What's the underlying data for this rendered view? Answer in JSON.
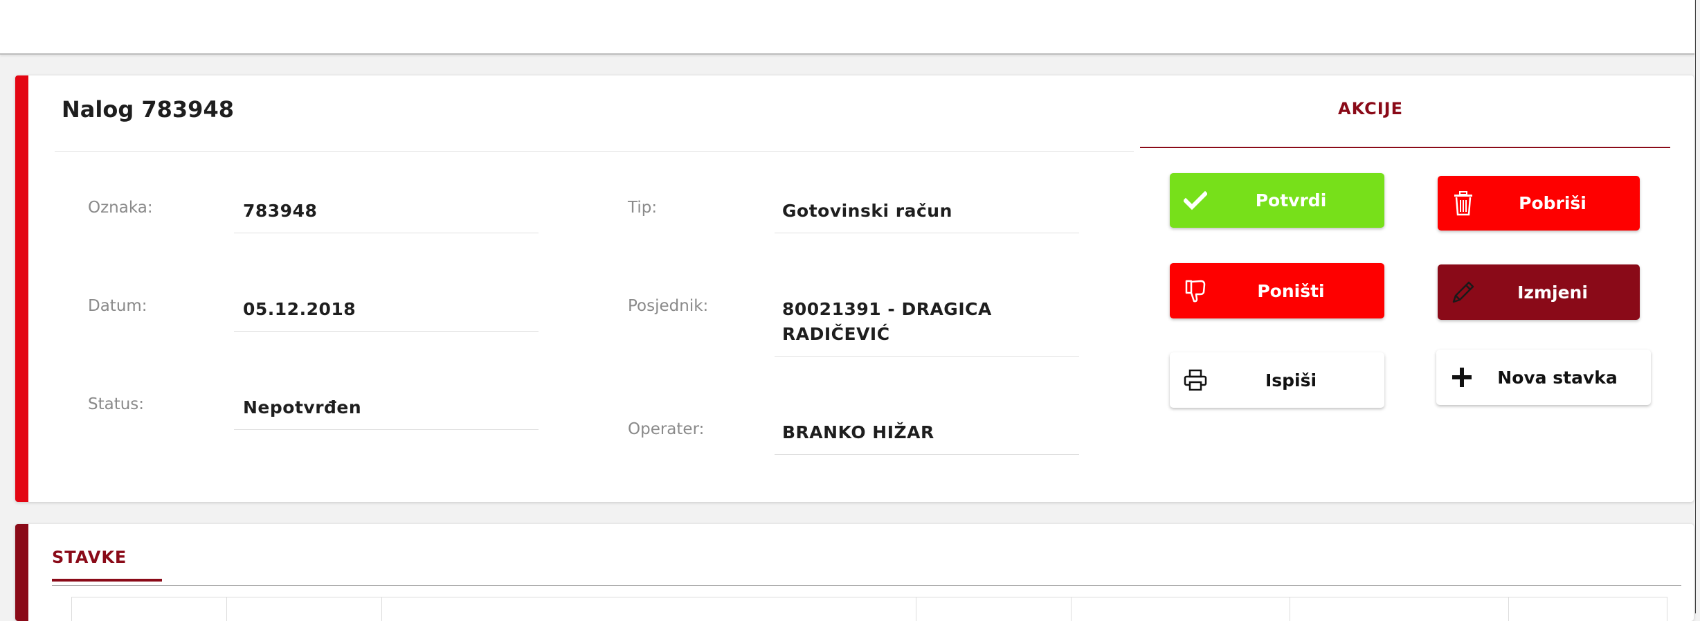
{
  "order": {
    "title": "Nalog 783948",
    "fields": {
      "oznaka": {
        "label": "Oznaka:",
        "value": "783948"
      },
      "datum": {
        "label": "Datum:",
        "value": "05.12.2018"
      },
      "status": {
        "label": "Status:",
        "value": "Nepotvrđen"
      },
      "tip": {
        "label": "Tip:",
        "value": "Gotovinski račun"
      },
      "posjednik": {
        "label": "Posjednik:",
        "value_line1": "80021391 - DRAGICA",
        "value_line2": "RADIČEVIĆ"
      },
      "operater": {
        "label": "Operater:",
        "value": "BRANKO HIŽAR"
      }
    }
  },
  "actions": {
    "title": "AKCIJE",
    "buttons": {
      "potvrdi": {
        "label": "Potvrdi",
        "icon": "check-icon",
        "color": "#77e01a"
      },
      "pobrisi": {
        "label": "Pobriši",
        "icon": "trash-icon",
        "color": "#fe0000"
      },
      "ponisti": {
        "label": "Poništi",
        "icon": "thumbs-down-icon",
        "color": "#fe0000"
      },
      "izmijeni": {
        "label": "Izmjeni",
        "icon": "pencil-icon",
        "color": "#8a0a18"
      },
      "ispisi": {
        "label": "Ispiši",
        "icon": "printer-icon",
        "color": "#ffffff"
      },
      "nova_stavka": {
        "label": "Nova stavka",
        "icon": "plus-icon",
        "color": "#ffffff"
      }
    }
  },
  "items": {
    "tab_label": "STAVKE"
  },
  "colors": {
    "accent_red": "#e30613",
    "dark_red": "#8a0a18",
    "green": "#77e01a"
  }
}
